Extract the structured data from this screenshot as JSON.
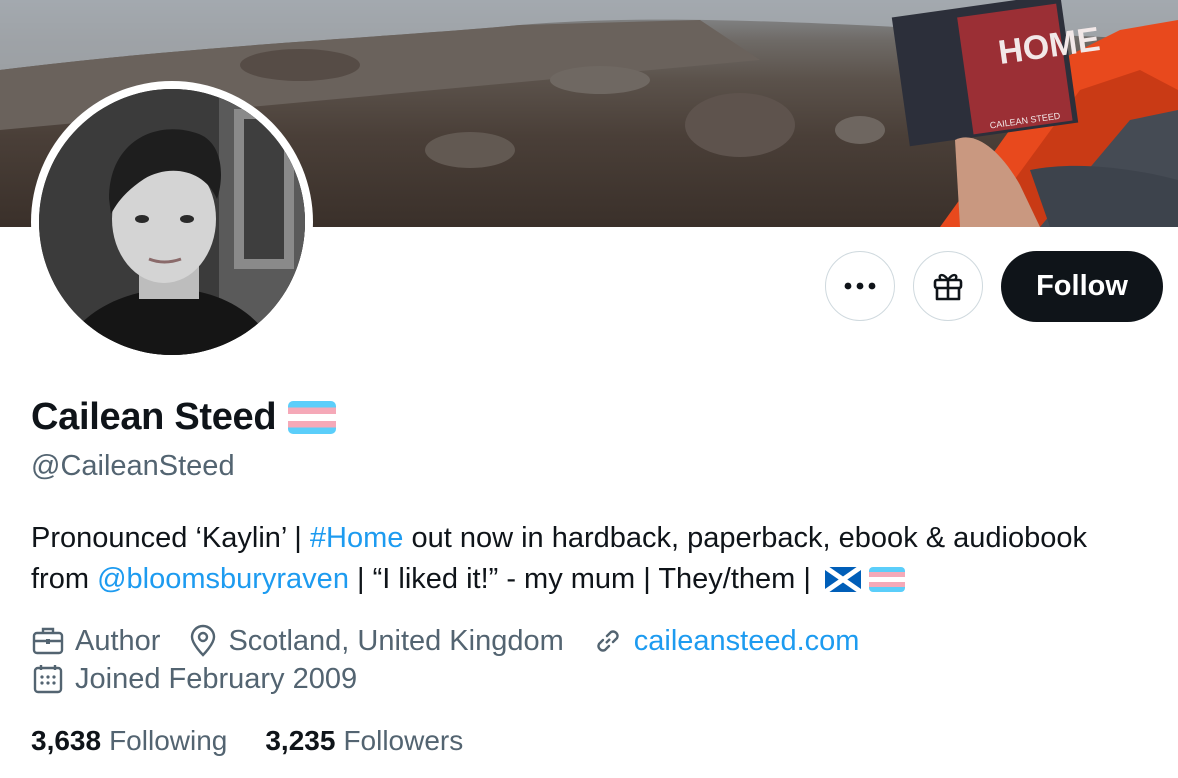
{
  "profile": {
    "name": "Cailean Steed",
    "handle": "@CaileanSteed",
    "bio": {
      "part1": "Pronounced ‘Kaylin’ | ",
      "hashtag": "#Home",
      "part2": " out now in hardback, paperback, ebook & audiobook from ",
      "mention": "@bloomsburyraven",
      "part3": " | “I liked it!” - my mum | They/them | "
    },
    "occupation": "Author",
    "location": "Scotland, United Kingdom",
    "website": "caileansteed.com",
    "joined": "Joined February 2009"
  },
  "stats": {
    "following_count": "3,638",
    "following_label": "Following",
    "followers_count": "3,235",
    "followers_label": "Followers"
  },
  "actions": {
    "follow_label": "Follow"
  },
  "banner": {
    "book_title": "HOME",
    "book_author": "CAILEAN STEED"
  },
  "icons": {
    "more": "more-icon",
    "gift": "gift-icon",
    "briefcase": "briefcase-icon",
    "location": "location-pin-icon",
    "link": "link-icon",
    "calendar": "calendar-icon",
    "flag": "transgender-flag-icon",
    "saltire": "scotland-flag-icon"
  },
  "colors": {
    "accent": "#1d9bf0",
    "text": "#0f1419",
    "secondary": "#536471",
    "follow_bg": "#0f1419"
  }
}
